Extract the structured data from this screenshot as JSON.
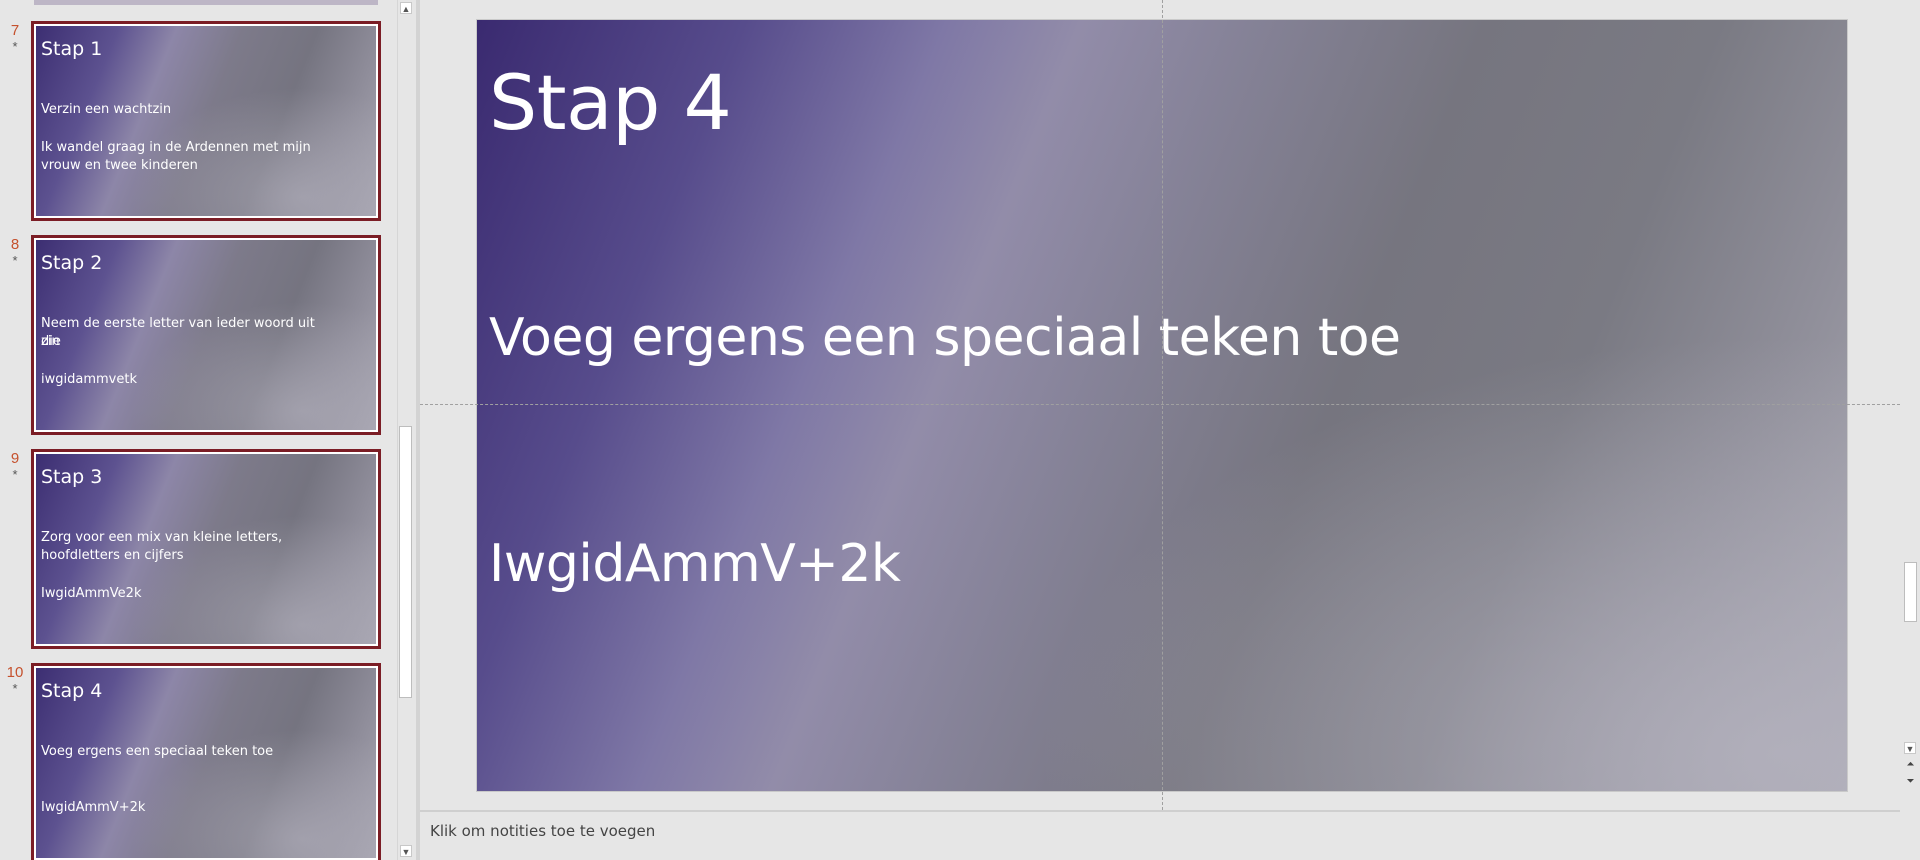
{
  "thumbnails": [
    {
      "number": "7",
      "marker": "*",
      "title": "Stap 1",
      "lines": [
        "Verzin een wachtzin",
        "Ik wandel graag in de Ardennen met mijn",
        "vrouw en twee kinderen"
      ]
    },
    {
      "number": "8",
      "marker": "*",
      "title": "Stap 2",
      "lines": [
        "Neem de eerste letter van ieder woord uit die",
        "zin",
        "iwgidammvetk"
      ]
    },
    {
      "number": "9",
      "marker": "*",
      "title": "Stap 3",
      "lines": [
        "Zorg voor een mix van kleine letters,",
        "hoofdletters en cijfers",
        "IwgidAmmVe2k"
      ]
    },
    {
      "number": "10",
      "marker": "*",
      "title": "Stap 4",
      "lines": [
        "Voeg ergens een speciaal teken toe",
        "IwgidAmmV+2k"
      ]
    }
  ],
  "slide": {
    "title": "Stap 4",
    "line1": "Voeg ergens een speciaal teken toe",
    "line2": "IwgidAmmV+2k"
  },
  "notes": {
    "placeholder": "Klik om notities toe te voegen"
  },
  "icons": {
    "scroll_up": "scroll-up-arrow",
    "scroll_down": "scroll-down-arrow",
    "prev_slide": "previous-slide-double-chevron",
    "next_slide": "next-slide-double-chevron"
  },
  "colors": {
    "selected_border": "#7b1d25",
    "slide_number": "#c5512d",
    "slide_gradient_start": "#3a2a70",
    "slide_gradient_end": "#a9a8b2"
  }
}
